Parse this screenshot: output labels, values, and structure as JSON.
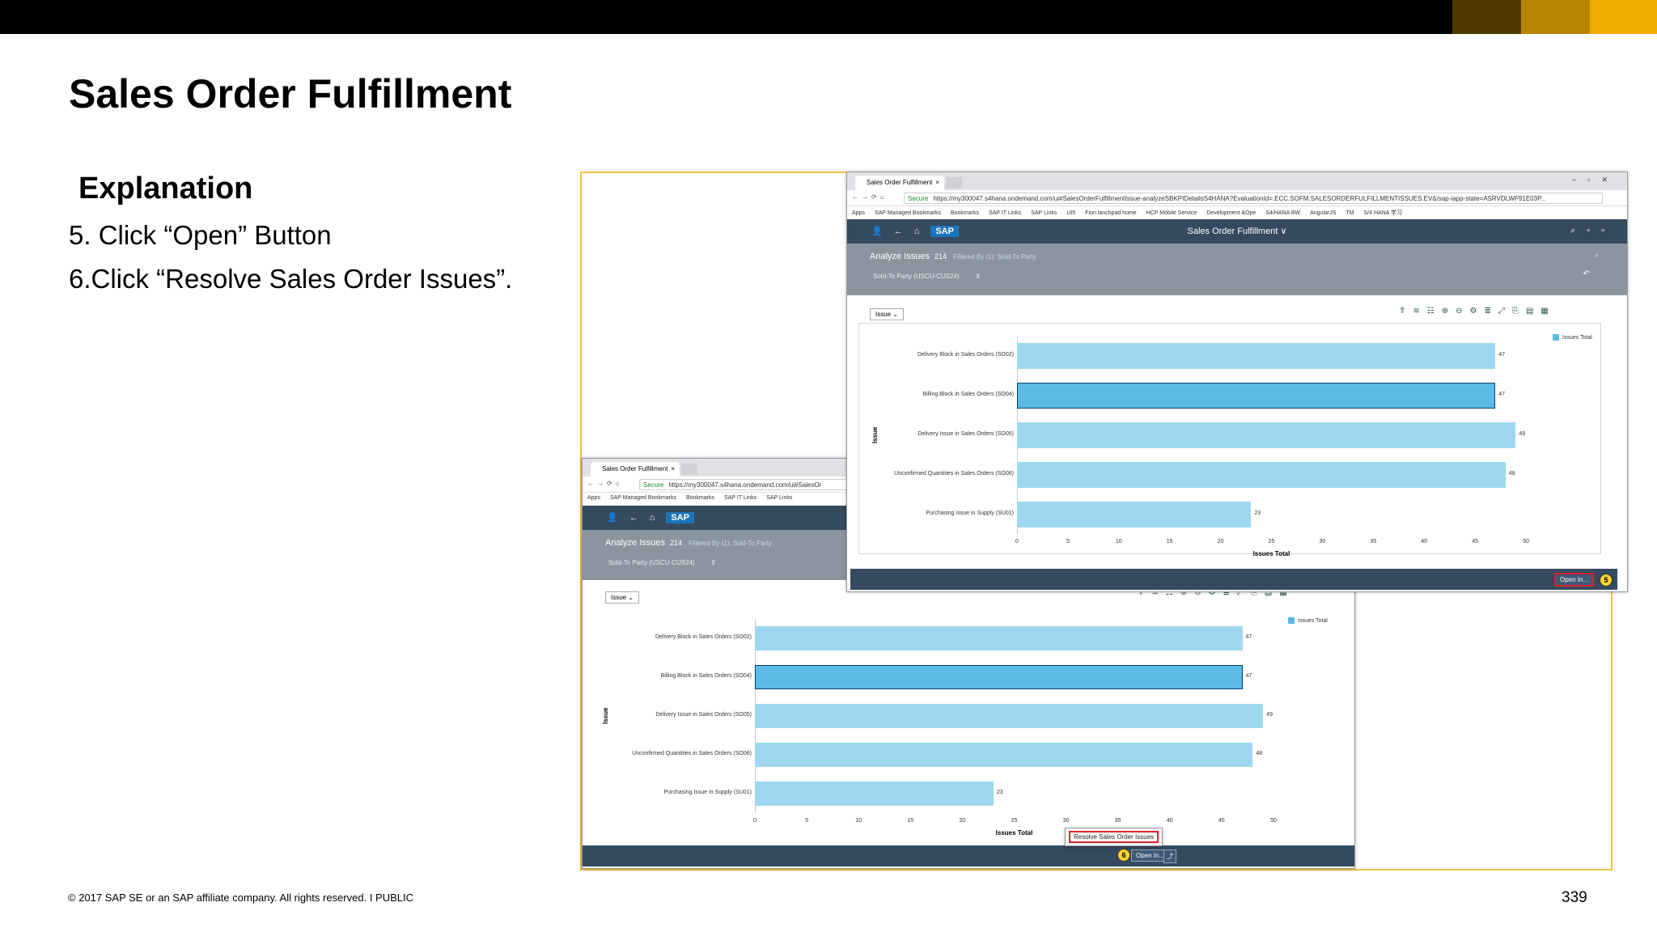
{
  "slide": {
    "title": "Sales Order Fulfillment",
    "explanation_heading": "Explanation",
    "steps": [
      "5. Click “Open” Button",
      "6.Click “Resolve Sales Order Issues”."
    ],
    "footer": "© 2017 SAP SE or an SAP affiliate company. All rights reserved.   I   PUBLIC",
    "page_number": "339",
    "brand_colors": [
      "#000000",
      "#4f3a00",
      "#b98300",
      "#f0ab00"
    ]
  },
  "browser": {
    "tab_title": "Sales Order Fulfillment",
    "tab_close": "×",
    "secure_label": "Secure",
    "url_full": "https://my300047.s4hana.ondemand.com/ui#SalesOrderFulfillmentIssue-analyzeSBKPIDetailsS4HANA?EvaluationId=.ECC.SOFM.SALESORDERFULFILLMENTISSUES.EV&/sap-iapp-state=ASRVDLWF91E03P...",
    "url_short": "https://my300047.s4hana.ondemand.com/ui#SalesOr",
    "bookmarks_full": [
      "Apps",
      "SAP Managed Bookmarks",
      "Bookmarks",
      "SAP IT Links",
      "SAP Links",
      "UI5",
      "Fiori lanchpad home",
      "HCP Mobile Service",
      "Development &Ope",
      "S4/HANA BW",
      "AngularJS",
      "TM",
      "S/4 HANA 学习"
    ],
    "bookmarks_short": [
      "Apps",
      "SAP Managed Bookmarks",
      "Bookmarks",
      "SAP IT Links",
      "SAP Links"
    ]
  },
  "shell": {
    "logo": "SAP",
    "app_title": "Sales Order Fulfillment ∨"
  },
  "header": {
    "title": "Analyze Issues",
    "count": "214",
    "filtered_by": "Filtered By (1): Sold-To Party",
    "filter_chip": "Sold-To Party (USCU-CUS24)"
  },
  "chart_select": "Issue",
  "open_button": "Open In...",
  "resolve_action": "Resolve Sales Order Issues",
  "badges": {
    "step5": "5",
    "step6": "6"
  },
  "chart_data": {
    "type": "bar",
    "orientation": "horizontal",
    "categories": [
      "Delivery Block in Sales Orders (SO02)",
      "Billing Block in Sales Orders (SO04)",
      "Delivery Issue in Sales Orders (SO05)",
      "Unconfirmed Quantities in Sales Orders (SO06)",
      "Purchasing Issue in Supply (SU01)"
    ],
    "series": [
      {
        "name": "Issues Total",
        "values": [
          47,
          47,
          49,
          48,
          23
        ]
      }
    ],
    "selected_index": 1,
    "xlabel": "Issues Total",
    "ylabel": "Issue",
    "xlim": [
      0,
      50
    ],
    "xticks": [
      0,
      5,
      10,
      15,
      20,
      25,
      30,
      35,
      40,
      45,
      50
    ],
    "legend": "top-right",
    "colors": {
      "bar": "#9fd7f1",
      "selected": "#5cbae6"
    }
  }
}
